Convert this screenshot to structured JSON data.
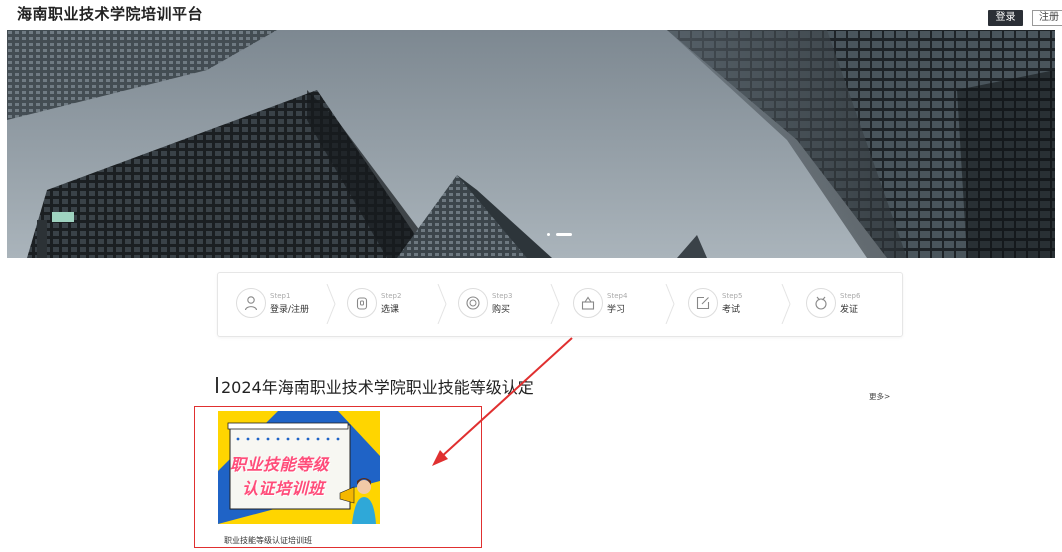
{
  "header": {
    "title": "海南职业技术学院培训平台",
    "login_label": "登录",
    "register_label": "注册"
  },
  "banner": {
    "slides_count": 2,
    "active_index": 1
  },
  "steps": [
    {
      "num": "Step1",
      "label": "登录/注册",
      "icon": "user-icon"
    },
    {
      "num": "Step2",
      "label": "选课",
      "icon": "lock-icon"
    },
    {
      "num": "Step3",
      "label": "购买",
      "icon": "coin-icon"
    },
    {
      "num": "Step4",
      "label": "学习",
      "icon": "lamp-icon"
    },
    {
      "num": "Step5",
      "label": "考试",
      "icon": "edit-icon"
    },
    {
      "num": "Step6",
      "label": "发证",
      "icon": "medal-icon"
    }
  ],
  "section": {
    "title": "2024年海南职业技术学院职业技能等级认定",
    "more_label": "更多>"
  },
  "courses": [
    {
      "name": "职业技能等级认证培训班",
      "thumb_line1": "职业技能等级",
      "thumb_line2": "认证培训班"
    }
  ],
  "colors": {
    "annotation": "#e03030",
    "thumb_blue": "#1f63c6",
    "thumb_yellow": "#ffd500",
    "thumb_text": "#ff4d7a",
    "login_bg": "#2b2f36"
  }
}
